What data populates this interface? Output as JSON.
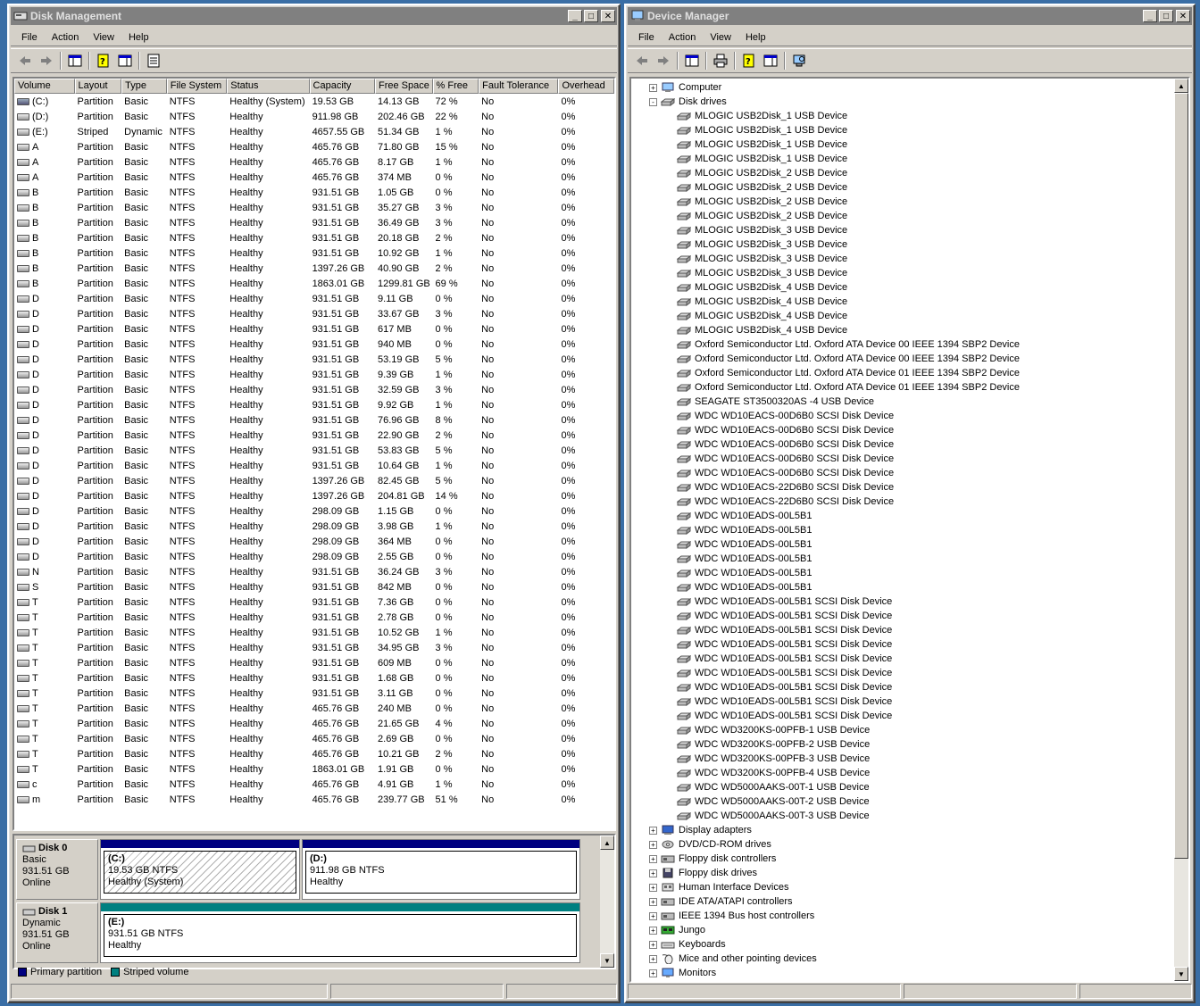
{
  "disk_management": {
    "title": "Disk Management",
    "menu": [
      "File",
      "Action",
      "View",
      "Help"
    ],
    "columns": [
      "Volume",
      "Layout",
      "Type",
      "File System",
      "Status",
      "Capacity",
      "Free Space",
      "% Free",
      "Fault Tolerance",
      "Overhead"
    ],
    "volumes": [
      [
        "(C:)",
        "Partition",
        "Basic",
        "NTFS",
        "Healthy (System)",
        "19.53 GB",
        "14.13 GB",
        "72 %",
        "No",
        "0%"
      ],
      [
        "(D:)",
        "Partition",
        "Basic",
        "NTFS",
        "Healthy",
        "911.98 GB",
        "202.46 GB",
        "22 %",
        "No",
        "0%"
      ],
      [
        "(E:)",
        "Striped",
        "Dynamic",
        "NTFS",
        "Healthy",
        "4657.55 GB",
        "51.34 GB",
        "1 %",
        "No",
        "0%"
      ],
      [
        "A",
        "Partition",
        "Basic",
        "NTFS",
        "Healthy",
        "465.76 GB",
        "71.80 GB",
        "15 %",
        "No",
        "0%"
      ],
      [
        "A",
        "Partition",
        "Basic",
        "NTFS",
        "Healthy",
        "465.76 GB",
        "8.17 GB",
        "1 %",
        "No",
        "0%"
      ],
      [
        "A",
        "Partition",
        "Basic",
        "NTFS",
        "Healthy",
        "465.76 GB",
        "374 MB",
        "0 %",
        "No",
        "0%"
      ],
      [
        "B",
        "Partition",
        "Basic",
        "NTFS",
        "Healthy",
        "931.51 GB",
        "1.05 GB",
        "0 %",
        "No",
        "0%"
      ],
      [
        "B",
        "Partition",
        "Basic",
        "NTFS",
        "Healthy",
        "931.51 GB",
        "35.27 GB",
        "3 %",
        "No",
        "0%"
      ],
      [
        "B",
        "Partition",
        "Basic",
        "NTFS",
        "Healthy",
        "931.51 GB",
        "36.49 GB",
        "3 %",
        "No",
        "0%"
      ],
      [
        "B",
        "Partition",
        "Basic",
        "NTFS",
        "Healthy",
        "931.51 GB",
        "20.18 GB",
        "2 %",
        "No",
        "0%"
      ],
      [
        "B",
        "Partition",
        "Basic",
        "NTFS",
        "Healthy",
        "931.51 GB",
        "10.92 GB",
        "1 %",
        "No",
        "0%"
      ],
      [
        "B",
        "Partition",
        "Basic",
        "NTFS",
        "Healthy",
        "1397.26 GB",
        "40.90 GB",
        "2 %",
        "No",
        "0%"
      ],
      [
        "B",
        "Partition",
        "Basic",
        "NTFS",
        "Healthy",
        "1863.01 GB",
        "1299.81 GB",
        "69 %",
        "No",
        "0%"
      ],
      [
        "D",
        "Partition",
        "Basic",
        "NTFS",
        "Healthy",
        "931.51 GB",
        "9.11 GB",
        "0 %",
        "No",
        "0%"
      ],
      [
        "D",
        "Partition",
        "Basic",
        "NTFS",
        "Healthy",
        "931.51 GB",
        "33.67 GB",
        "3 %",
        "No",
        "0%"
      ],
      [
        "D",
        "Partition",
        "Basic",
        "NTFS",
        "Healthy",
        "931.51 GB",
        "617 MB",
        "0 %",
        "No",
        "0%"
      ],
      [
        "D",
        "Partition",
        "Basic",
        "NTFS",
        "Healthy",
        "931.51 GB",
        "940 MB",
        "0 %",
        "No",
        "0%"
      ],
      [
        "D",
        "Partition",
        "Basic",
        "NTFS",
        "Healthy",
        "931.51 GB",
        "53.19 GB",
        "5 %",
        "No",
        "0%"
      ],
      [
        "D",
        "Partition",
        "Basic",
        "NTFS",
        "Healthy",
        "931.51 GB",
        "9.39 GB",
        "1 %",
        "No",
        "0%"
      ],
      [
        "D",
        "Partition",
        "Basic",
        "NTFS",
        "Healthy",
        "931.51 GB",
        "32.59 GB",
        "3 %",
        "No",
        "0%"
      ],
      [
        "D",
        "Partition",
        "Basic",
        "NTFS",
        "Healthy",
        "931.51 GB",
        "9.92 GB",
        "1 %",
        "No",
        "0%"
      ],
      [
        "D",
        "Partition",
        "Basic",
        "NTFS",
        "Healthy",
        "931.51 GB",
        "76.96 GB",
        "8 %",
        "No",
        "0%"
      ],
      [
        "D",
        "Partition",
        "Basic",
        "NTFS",
        "Healthy",
        "931.51 GB",
        "22.90 GB",
        "2 %",
        "No",
        "0%"
      ],
      [
        "D",
        "Partition",
        "Basic",
        "NTFS",
        "Healthy",
        "931.51 GB",
        "53.83 GB",
        "5 %",
        "No",
        "0%"
      ],
      [
        "D",
        "Partition",
        "Basic",
        "NTFS",
        "Healthy",
        "931.51 GB",
        "10.64 GB",
        "1 %",
        "No",
        "0%"
      ],
      [
        "D",
        "Partition",
        "Basic",
        "NTFS",
        "Healthy",
        "1397.26 GB",
        "82.45 GB",
        "5 %",
        "No",
        "0%"
      ],
      [
        "D",
        "Partition",
        "Basic",
        "NTFS",
        "Healthy",
        "1397.26 GB",
        "204.81 GB",
        "14 %",
        "No",
        "0%"
      ],
      [
        "D",
        "Partition",
        "Basic",
        "NTFS",
        "Healthy",
        "298.09 GB",
        "1.15 GB",
        "0 %",
        "No",
        "0%"
      ],
      [
        "D",
        "Partition",
        "Basic",
        "NTFS",
        "Healthy",
        "298.09 GB",
        "3.98 GB",
        "1 %",
        "No",
        "0%"
      ],
      [
        "D",
        "Partition",
        "Basic",
        "NTFS",
        "Healthy",
        "298.09 GB",
        "364 MB",
        "0 %",
        "No",
        "0%"
      ],
      [
        "D",
        "Partition",
        "Basic",
        "NTFS",
        "Healthy",
        "298.09 GB",
        "2.55 GB",
        "0 %",
        "No",
        "0%"
      ],
      [
        "N",
        "Partition",
        "Basic",
        "NTFS",
        "Healthy",
        "931.51 GB",
        "36.24 GB",
        "3 %",
        "No",
        "0%"
      ],
      [
        "S",
        "Partition",
        "Basic",
        "NTFS",
        "Healthy",
        "931.51 GB",
        "842 MB",
        "0 %",
        "No",
        "0%"
      ],
      [
        "T",
        "Partition",
        "Basic",
        "NTFS",
        "Healthy",
        "931.51 GB",
        "7.36 GB",
        "0 %",
        "No",
        "0%"
      ],
      [
        "T",
        "Partition",
        "Basic",
        "NTFS",
        "Healthy",
        "931.51 GB",
        "2.78 GB",
        "0 %",
        "No",
        "0%"
      ],
      [
        "T",
        "Partition",
        "Basic",
        "NTFS",
        "Healthy",
        "931.51 GB",
        "10.52 GB",
        "1 %",
        "No",
        "0%"
      ],
      [
        "T",
        "Partition",
        "Basic",
        "NTFS",
        "Healthy",
        "931.51 GB",
        "34.95 GB",
        "3 %",
        "No",
        "0%"
      ],
      [
        "T",
        "Partition",
        "Basic",
        "NTFS",
        "Healthy",
        "931.51 GB",
        "609 MB",
        "0 %",
        "No",
        "0%"
      ],
      [
        "T",
        "Partition",
        "Basic",
        "NTFS",
        "Healthy",
        "931.51 GB",
        "1.68 GB",
        "0 %",
        "No",
        "0%"
      ],
      [
        "T",
        "Partition",
        "Basic",
        "NTFS",
        "Healthy",
        "931.51 GB",
        "3.11 GB",
        "0 %",
        "No",
        "0%"
      ],
      [
        "T",
        "Partition",
        "Basic",
        "NTFS",
        "Healthy",
        "465.76 GB",
        "240 MB",
        "0 %",
        "No",
        "0%"
      ],
      [
        "T",
        "Partition",
        "Basic",
        "NTFS",
        "Healthy",
        "465.76 GB",
        "21.65 GB",
        "4 %",
        "No",
        "0%"
      ],
      [
        "T",
        "Partition",
        "Basic",
        "NTFS",
        "Healthy",
        "465.76 GB",
        "2.69 GB",
        "0 %",
        "No",
        "0%"
      ],
      [
        "T",
        "Partition",
        "Basic",
        "NTFS",
        "Healthy",
        "465.76 GB",
        "10.21 GB",
        "2 %",
        "No",
        "0%"
      ],
      [
        "T",
        "Partition",
        "Basic",
        "NTFS",
        "Healthy",
        "1863.01 GB",
        "1.91 GB",
        "0 %",
        "No",
        "0%"
      ],
      [
        "c",
        "Partition",
        "Basic",
        "NTFS",
        "Healthy",
        "465.76 GB",
        "4.91 GB",
        "1 %",
        "No",
        "0%"
      ],
      [
        "m",
        "Partition",
        "Basic",
        "NTFS",
        "Healthy",
        "465.76 GB",
        "239.77 GB",
        "51 %",
        "No",
        "0%"
      ]
    ],
    "disks": [
      {
        "name": "Disk 0",
        "type": "Basic",
        "size": "931.51 GB",
        "state": "Online",
        "partitions": [
          {
            "label": "(C:)",
            "size": "19.53 GB NTFS",
            "status": "Healthy (System)"
          },
          {
            "label": "(D:)",
            "size": "911.98 GB NTFS",
            "status": "Healthy"
          }
        ]
      },
      {
        "name": "Disk 1",
        "type": "Dynamic",
        "size": "931.51 GB",
        "state": "Online",
        "partitions": [
          {
            "label": "(E:)",
            "size": "931.51 GB NTFS",
            "status": "Healthy"
          }
        ]
      }
    ],
    "legend": [
      {
        "label": "Primary partition",
        "color": "#000080"
      },
      {
        "label": "Striped volume",
        "color": "#008080"
      }
    ]
  },
  "device_manager": {
    "title": "Device Manager",
    "menu": [
      "File",
      "Action",
      "View",
      "Help"
    ],
    "tree": [
      {
        "label": "Computer",
        "level": 1,
        "expander": "+",
        "icon": "computer-icon"
      },
      {
        "label": "Disk drives",
        "level": 1,
        "expander": "-",
        "icon": "disk-drive-icon"
      },
      {
        "label": "MLOGIC USB2Disk_1 USB Device",
        "level": 2,
        "icon": "disk-drive-icon"
      },
      {
        "label": "MLOGIC USB2Disk_1 USB Device",
        "level": 2,
        "icon": "disk-drive-icon"
      },
      {
        "label": "MLOGIC USB2Disk_1 USB Device",
        "level": 2,
        "icon": "disk-drive-icon"
      },
      {
        "label": "MLOGIC USB2Disk_1 USB Device",
        "level": 2,
        "icon": "disk-drive-icon"
      },
      {
        "label": "MLOGIC USB2Disk_2 USB Device",
        "level": 2,
        "icon": "disk-drive-icon"
      },
      {
        "label": "MLOGIC USB2Disk_2 USB Device",
        "level": 2,
        "icon": "disk-drive-icon"
      },
      {
        "label": "MLOGIC USB2Disk_2 USB Device",
        "level": 2,
        "icon": "disk-drive-icon"
      },
      {
        "label": "MLOGIC USB2Disk_2 USB Device",
        "level": 2,
        "icon": "disk-drive-icon"
      },
      {
        "label": "MLOGIC USB2Disk_3 USB Device",
        "level": 2,
        "icon": "disk-drive-icon"
      },
      {
        "label": "MLOGIC USB2Disk_3 USB Device",
        "level": 2,
        "icon": "disk-drive-icon"
      },
      {
        "label": "MLOGIC USB2Disk_3 USB Device",
        "level": 2,
        "icon": "disk-drive-icon"
      },
      {
        "label": "MLOGIC USB2Disk_3 USB Device",
        "level": 2,
        "icon": "disk-drive-icon"
      },
      {
        "label": "MLOGIC USB2Disk_4 USB Device",
        "level": 2,
        "icon": "disk-drive-icon"
      },
      {
        "label": "MLOGIC USB2Disk_4 USB Device",
        "level": 2,
        "icon": "disk-drive-icon"
      },
      {
        "label": "MLOGIC USB2Disk_4 USB Device",
        "level": 2,
        "icon": "disk-drive-icon"
      },
      {
        "label": "MLOGIC USB2Disk_4 USB Device",
        "level": 2,
        "icon": "disk-drive-icon"
      },
      {
        "label": "Oxford Semiconductor Ltd. Oxford ATA Device 00 IEEE 1394 SBP2 Device",
        "level": 2,
        "icon": "disk-drive-icon"
      },
      {
        "label": "Oxford Semiconductor Ltd. Oxford ATA Device 00 IEEE 1394 SBP2 Device",
        "level": 2,
        "icon": "disk-drive-icon"
      },
      {
        "label": "Oxford Semiconductor Ltd. Oxford ATA Device 01 IEEE 1394 SBP2 Device",
        "level": 2,
        "icon": "disk-drive-icon"
      },
      {
        "label": "Oxford Semiconductor Ltd. Oxford ATA Device 01 IEEE 1394 SBP2 Device",
        "level": 2,
        "icon": "disk-drive-icon"
      },
      {
        "label": "SEAGATE ST3500320AS   -4 USB Device",
        "level": 2,
        "icon": "disk-drive-icon"
      },
      {
        "label": "WDC WD10EACS-00D6B0 SCSI Disk Device",
        "level": 2,
        "icon": "disk-drive-icon"
      },
      {
        "label": "WDC WD10EACS-00D6B0 SCSI Disk Device",
        "level": 2,
        "icon": "disk-drive-icon"
      },
      {
        "label": "WDC WD10EACS-00D6B0 SCSI Disk Device",
        "level": 2,
        "icon": "disk-drive-icon"
      },
      {
        "label": "WDC WD10EACS-00D6B0 SCSI Disk Device",
        "level": 2,
        "icon": "disk-drive-icon"
      },
      {
        "label": "WDC WD10EACS-00D6B0 SCSI Disk Device",
        "level": 2,
        "icon": "disk-drive-icon"
      },
      {
        "label": "WDC WD10EACS-22D6B0 SCSI Disk Device",
        "level": 2,
        "icon": "disk-drive-icon"
      },
      {
        "label": "WDC WD10EACS-22D6B0 SCSI Disk Device",
        "level": 2,
        "icon": "disk-drive-icon"
      },
      {
        "label": "WDC WD10EADS-00L5B1",
        "level": 2,
        "icon": "disk-drive-icon"
      },
      {
        "label": "WDC WD10EADS-00L5B1",
        "level": 2,
        "icon": "disk-drive-icon"
      },
      {
        "label": "WDC WD10EADS-00L5B1",
        "level": 2,
        "icon": "disk-drive-icon"
      },
      {
        "label": "WDC WD10EADS-00L5B1",
        "level": 2,
        "icon": "disk-drive-icon"
      },
      {
        "label": "WDC WD10EADS-00L5B1",
        "level": 2,
        "icon": "disk-drive-icon"
      },
      {
        "label": "WDC WD10EADS-00L5B1",
        "level": 2,
        "icon": "disk-drive-icon"
      },
      {
        "label": "WDC WD10EADS-00L5B1 SCSI Disk Device",
        "level": 2,
        "icon": "disk-drive-icon"
      },
      {
        "label": "WDC WD10EADS-00L5B1 SCSI Disk Device",
        "level": 2,
        "icon": "disk-drive-icon"
      },
      {
        "label": "WDC WD10EADS-00L5B1 SCSI Disk Device",
        "level": 2,
        "icon": "disk-drive-icon"
      },
      {
        "label": "WDC WD10EADS-00L5B1 SCSI Disk Device",
        "level": 2,
        "icon": "disk-drive-icon"
      },
      {
        "label": "WDC WD10EADS-00L5B1 SCSI Disk Device",
        "level": 2,
        "icon": "disk-drive-icon"
      },
      {
        "label": "WDC WD10EADS-00L5B1 SCSI Disk Device",
        "level": 2,
        "icon": "disk-drive-icon"
      },
      {
        "label": "WDC WD10EADS-00L5B1 SCSI Disk Device",
        "level": 2,
        "icon": "disk-drive-icon"
      },
      {
        "label": "WDC WD10EADS-00L5B1 SCSI Disk Device",
        "level": 2,
        "icon": "disk-drive-icon"
      },
      {
        "label": "WDC WD10EADS-00L5B1 SCSI Disk Device",
        "level": 2,
        "icon": "disk-drive-icon"
      },
      {
        "label": "WDC WD3200KS-00PFB-1 USB Device",
        "level": 2,
        "icon": "disk-drive-icon"
      },
      {
        "label": "WDC WD3200KS-00PFB-2 USB Device",
        "level": 2,
        "icon": "disk-drive-icon"
      },
      {
        "label": "WDC WD3200KS-00PFB-3 USB Device",
        "level": 2,
        "icon": "disk-drive-icon"
      },
      {
        "label": "WDC WD3200KS-00PFB-4 USB Device",
        "level": 2,
        "icon": "disk-drive-icon"
      },
      {
        "label": "WDC WD5000AAKS-00T-1 USB Device",
        "level": 2,
        "icon": "disk-drive-icon"
      },
      {
        "label": "WDC WD5000AAKS-00T-2 USB Device",
        "level": 2,
        "icon": "disk-drive-icon"
      },
      {
        "label": "WDC WD5000AAKS-00T-3 USB Device",
        "level": 2,
        "icon": "disk-drive-icon"
      },
      {
        "label": "Display adapters",
        "level": 1,
        "expander": "+",
        "icon": "display-adapter-icon"
      },
      {
        "label": "DVD/CD-ROM drives",
        "level": 1,
        "expander": "+",
        "icon": "cdrom-icon"
      },
      {
        "label": "Floppy disk controllers",
        "level": 1,
        "expander": "+",
        "icon": "controller-icon"
      },
      {
        "label": "Floppy disk drives",
        "level": 1,
        "expander": "+",
        "icon": "floppy-icon"
      },
      {
        "label": "Human Interface Devices",
        "level": 1,
        "expander": "+",
        "icon": "hid-icon"
      },
      {
        "label": "IDE ATA/ATAPI controllers",
        "level": 1,
        "expander": "+",
        "icon": "controller-icon"
      },
      {
        "label": "IEEE 1394 Bus host controllers",
        "level": 1,
        "expander": "+",
        "icon": "controller-icon"
      },
      {
        "label": "Jungo",
        "level": 1,
        "expander": "+",
        "icon": "board-icon"
      },
      {
        "label": "Keyboards",
        "level": 1,
        "expander": "+",
        "icon": "keyboard-icon"
      },
      {
        "label": "Mice and other pointing devices",
        "level": 1,
        "expander": "+",
        "icon": "mouse-icon"
      },
      {
        "label": "Monitors",
        "level": 1,
        "expander": "+",
        "icon": "monitor-icon"
      }
    ]
  }
}
